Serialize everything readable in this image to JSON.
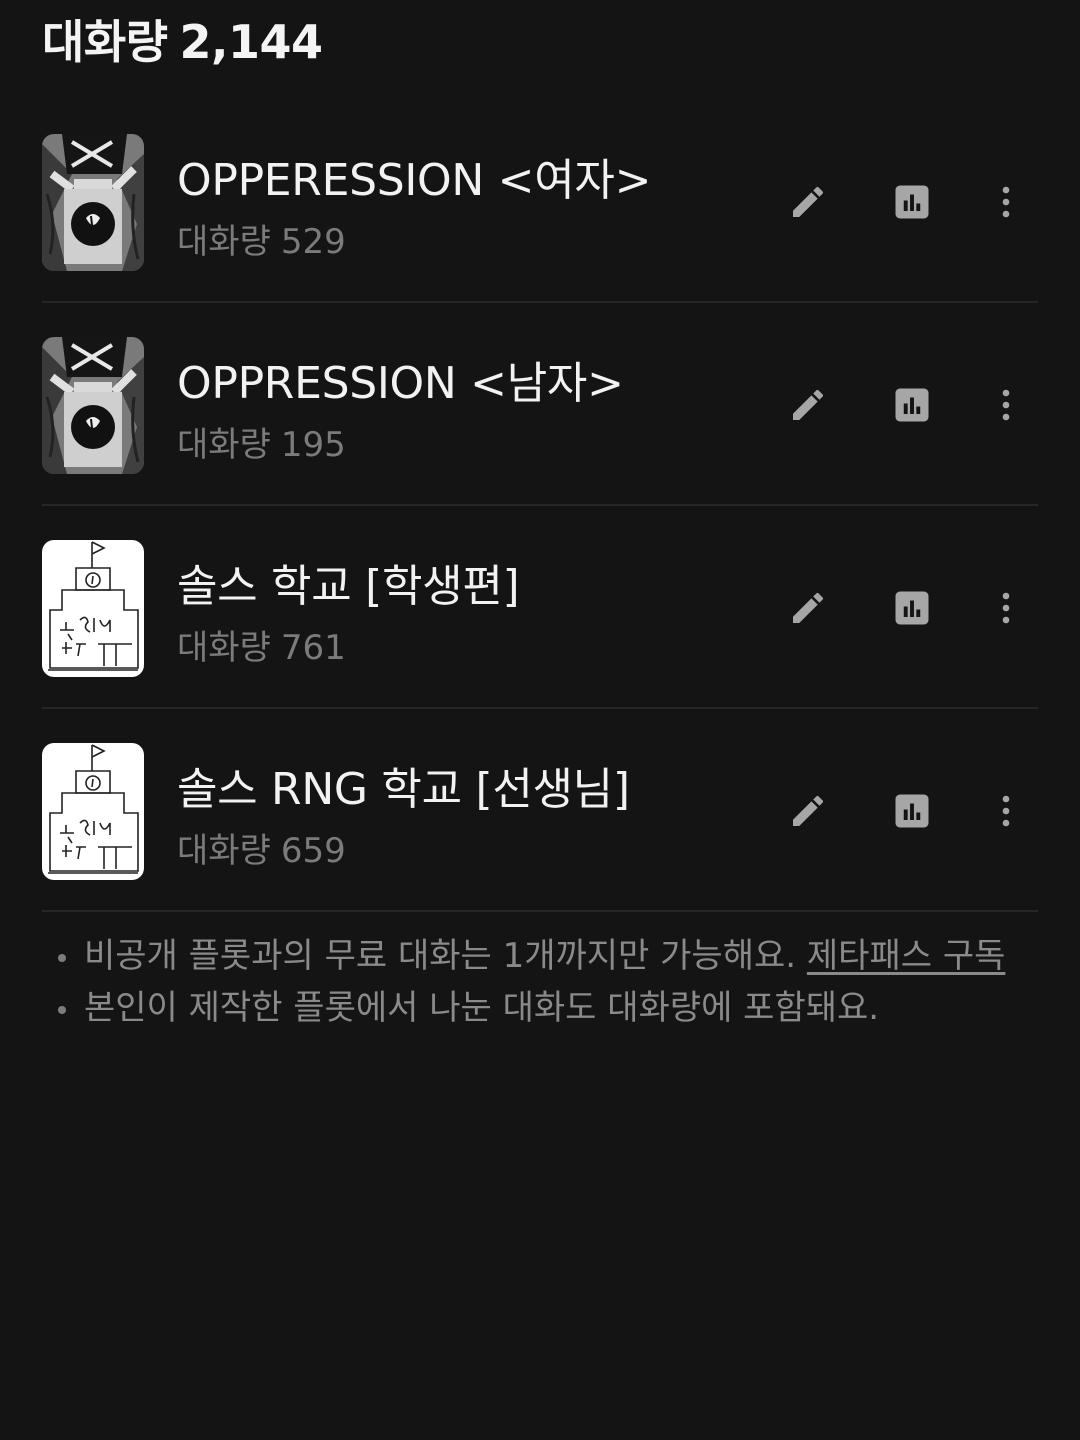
{
  "header": {
    "label": "대화량",
    "total": "2,144"
  },
  "plots": [
    {
      "title": "OPPERESSION <여자>",
      "count_label": "대화량",
      "count": "529",
      "thumbnail": "dark-figure-drawing"
    },
    {
      "title": "OPPRESSION <남자>",
      "count_label": "대화량",
      "count": "195",
      "thumbnail": "dark-figure-drawing"
    },
    {
      "title": "솔스 학교 [학생편]",
      "count_label": "대화량",
      "count": "761",
      "thumbnail": "school-sketch"
    },
    {
      "title": "솔스 RNG 학교 [선생님]",
      "count_label": "대화량",
      "count": "659",
      "thumbnail": "school-sketch"
    }
  ],
  "actions": {
    "edit_icon": "pencil-icon",
    "stats_icon": "bar-chart-icon",
    "more_icon": "more-vertical-icon"
  },
  "notes": {
    "note1_text": "비공개 플롯과의 무료 대화는 1개까지만 가능해요. ",
    "note1_link": "제타패스 구독",
    "note2_text": "본인이 제작한 플롯에서 나눈 대화도 대화량에 포함돼요."
  },
  "colors": {
    "background": "#141414",
    "primary_text": "#f2f2f2",
    "secondary_text": "#7b7b7b",
    "divider": "#262626",
    "icon": "#a6a6a6"
  }
}
